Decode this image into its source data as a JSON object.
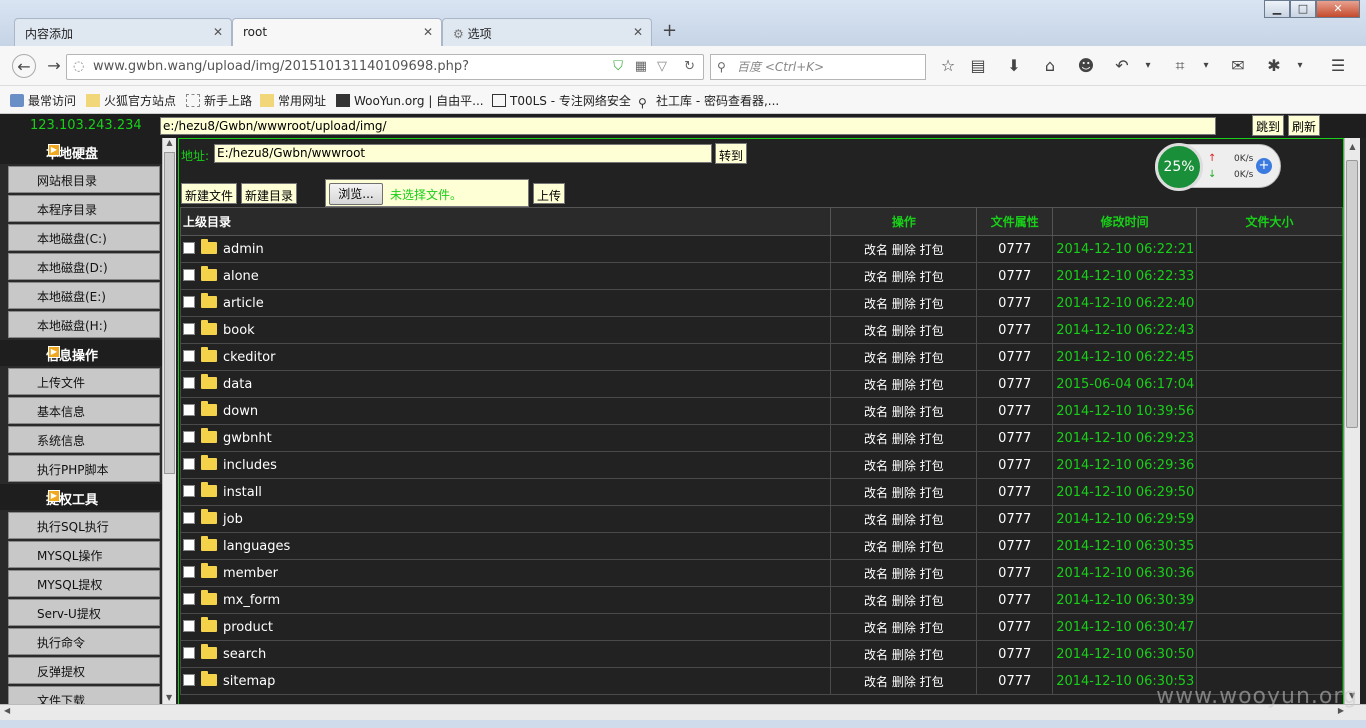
{
  "browser": {
    "tabs": [
      {
        "label": "内容添加"
      },
      {
        "label": "root"
      },
      {
        "label": "选项"
      }
    ],
    "url": "www.gwbn.wang/upload/img/201510131140109698.php?",
    "search_placeholder": "百度 <Ctrl+K>",
    "bookmarks": [
      "最常访问",
      "火狐官方站点",
      "新手上路",
      "常用网址",
      "WooYun.org | 自由平...",
      "T00LS - 专注网络安全",
      "社工库 - 密码查看器,..."
    ],
    "net_widget": {
      "percent": "25%",
      "up": "0K/s",
      "down": "0K/s"
    },
    "watermark": "www.wooyun.org"
  },
  "shell": {
    "ip": "123.103.243.234",
    "path": "e:/hezu8/Gwbn/wwwroot/upload/img/",
    "jump_label": "跳到",
    "refresh_label": "刷新",
    "address_label": "地址:",
    "address_value": "E:/hezu8/Gwbn/wwwroot",
    "goto_label": "转到",
    "new_file_label": "新建文件",
    "new_dir_label": "新建目录",
    "browse_label": "浏览...",
    "no_file_label": "未选择文件。",
    "upload_label": "上传"
  },
  "sidebar": {
    "sections": [
      {
        "title": "本地硬盘",
        "items": [
          "网站根目录",
          "本程序目录",
          "本地磁盘(C:)",
          "本地磁盘(D:)",
          "本地磁盘(E:)",
          "本地磁盘(H:)"
        ]
      },
      {
        "title": "信息操作",
        "items": [
          "上传文件",
          "基本信息",
          "系统信息",
          "执行PHP脚本"
        ]
      },
      {
        "title": "提权工具",
        "items": [
          "执行SQL执行",
          "MYSQL操作",
          "MYSQL提权",
          "Serv-U提权",
          "执行命令",
          "反弹提权",
          "文件下载"
        ]
      }
    ]
  },
  "table": {
    "headers": {
      "parent": "上级目录",
      "ops": "操作",
      "perm": "文件属性",
      "mtime": "修改时间",
      "size": "文件大小"
    },
    "ops_label": "改名 删除 打包",
    "rows": [
      {
        "name": "admin",
        "perm": "0777",
        "mtime": "2014-12-10 06:22:21"
      },
      {
        "name": "alone",
        "perm": "0777",
        "mtime": "2014-12-10 06:22:33"
      },
      {
        "name": "article",
        "perm": "0777",
        "mtime": "2014-12-10 06:22:40"
      },
      {
        "name": "book",
        "perm": "0777",
        "mtime": "2014-12-10 06:22:43"
      },
      {
        "name": "ckeditor",
        "perm": "0777",
        "mtime": "2014-12-10 06:22:45"
      },
      {
        "name": "data",
        "perm": "0777",
        "mtime": "2015-06-04 06:17:04"
      },
      {
        "name": "down",
        "perm": "0777",
        "mtime": "2014-12-10 10:39:56"
      },
      {
        "name": "gwbnht",
        "perm": "0777",
        "mtime": "2014-12-10 06:29:23"
      },
      {
        "name": "includes",
        "perm": "0777",
        "mtime": "2014-12-10 06:29:36"
      },
      {
        "name": "install",
        "perm": "0777",
        "mtime": "2014-12-10 06:29:50"
      },
      {
        "name": "job",
        "perm": "0777",
        "mtime": "2014-12-10 06:29:59"
      },
      {
        "name": "languages",
        "perm": "0777",
        "mtime": "2014-12-10 06:30:35"
      },
      {
        "name": "member",
        "perm": "0777",
        "mtime": "2014-12-10 06:30:36"
      },
      {
        "name": "mx_form",
        "perm": "0777",
        "mtime": "2014-12-10 06:30:39"
      },
      {
        "name": "product",
        "perm": "0777",
        "mtime": "2014-12-10 06:30:47"
      },
      {
        "name": "search",
        "perm": "0777",
        "mtime": "2014-12-10 06:30:50"
      },
      {
        "name": "sitemap",
        "perm": "0777",
        "mtime": "2014-12-10 06:30:53"
      }
    ]
  }
}
